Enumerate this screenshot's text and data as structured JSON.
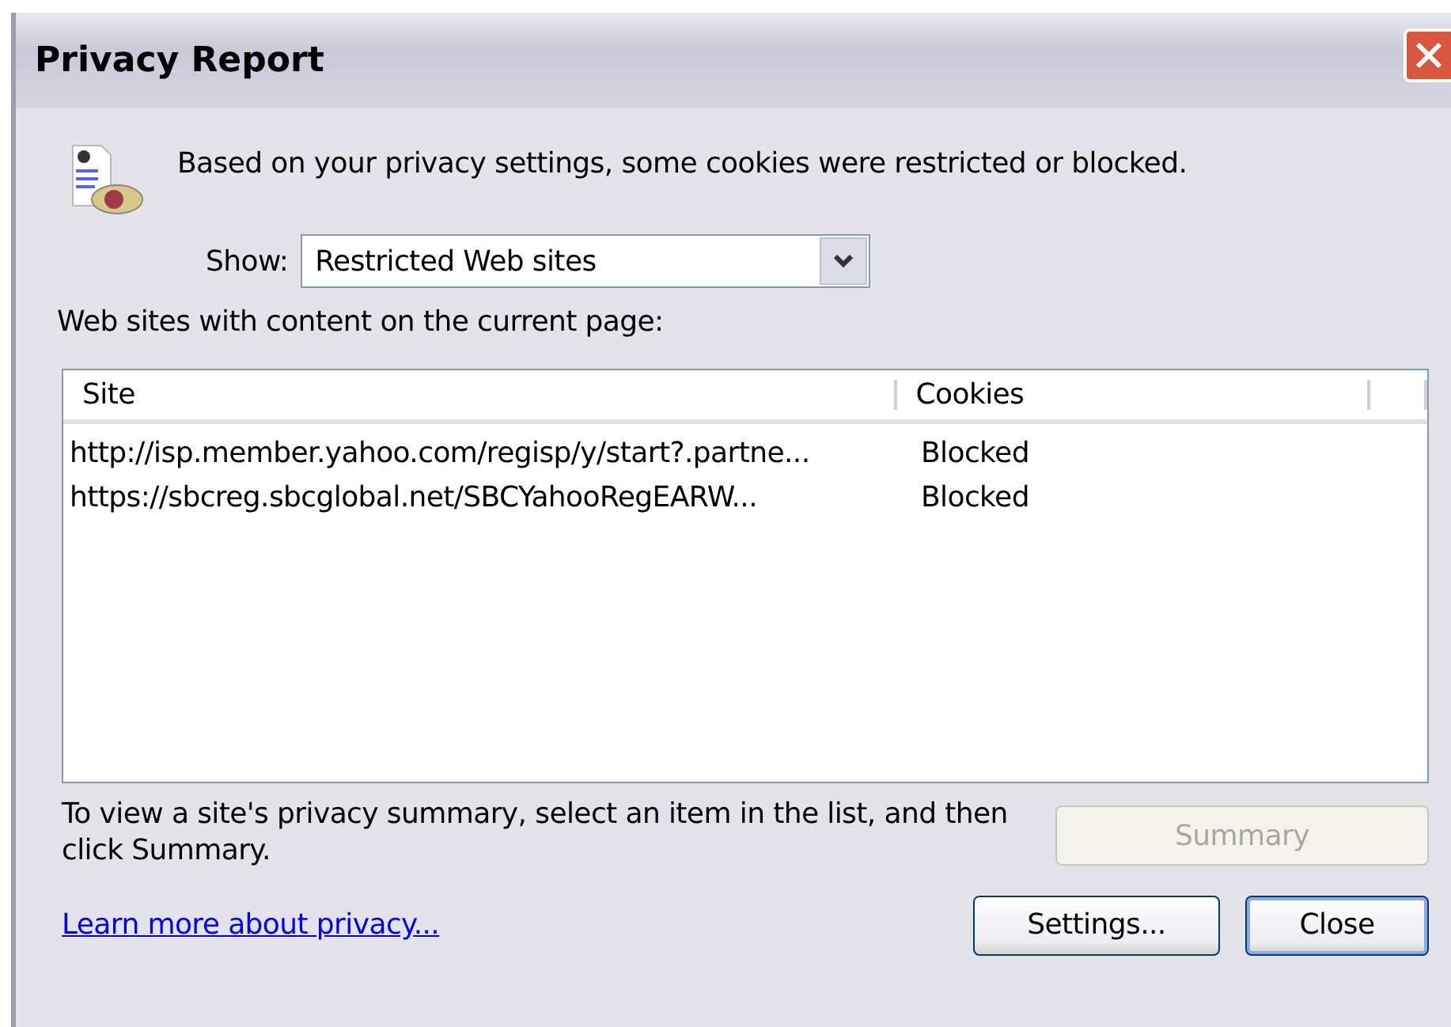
{
  "window": {
    "title": "Privacy Report"
  },
  "message": "Based on your privacy settings, some cookies were restricted or blocked.",
  "show": {
    "label": "Show:",
    "value": "Restricted Web sites"
  },
  "list_label": "Web sites with content on the current page:",
  "table": {
    "columns": [
      "Site",
      "Cookies"
    ],
    "rows": [
      {
        "site": "http://isp.member.yahoo.com/regisp/y/start?.partne...",
        "cookies": "Blocked",
        "selected": false
      },
      {
        "site": "https://sbcreg.sbcglobal.net/SBCYahooRegEARW...",
        "cookies": "Blocked",
        "selected": false
      }
    ]
  },
  "hint": "To view a site's privacy summary, select an item in the list, and then click Summary.",
  "summary_button": {
    "label": "Summary",
    "disabled": true
  },
  "link": "Learn more about privacy...",
  "buttons": [
    {
      "label": "Settings...",
      "default": false
    },
    {
      "label": "Close",
      "default": true
    }
  ]
}
